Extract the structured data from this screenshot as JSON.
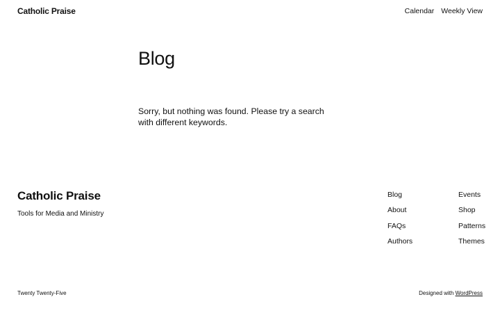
{
  "header": {
    "site_title": "Catholic Praise",
    "nav": [
      {
        "label": "Calendar"
      },
      {
        "label": "Weekly View"
      }
    ]
  },
  "main": {
    "heading": "Blog",
    "message": "Sorry, but nothing was found. Please try a search with different keywords."
  },
  "footer": {
    "site_title": "Catholic Praise",
    "tagline": "Tools for Media and Ministry",
    "nav_col1": [
      {
        "label": "Blog"
      },
      {
        "label": "About"
      },
      {
        "label": "FAQs"
      },
      {
        "label": "Authors"
      }
    ],
    "nav_col2": [
      {
        "label": "Events"
      },
      {
        "label": "Shop"
      },
      {
        "label": "Patterns"
      },
      {
        "label": "Themes"
      }
    ],
    "theme_name": "Twenty Twenty-Five",
    "credit_prefix": "Designed with",
    "credit_link": "WordPress"
  }
}
